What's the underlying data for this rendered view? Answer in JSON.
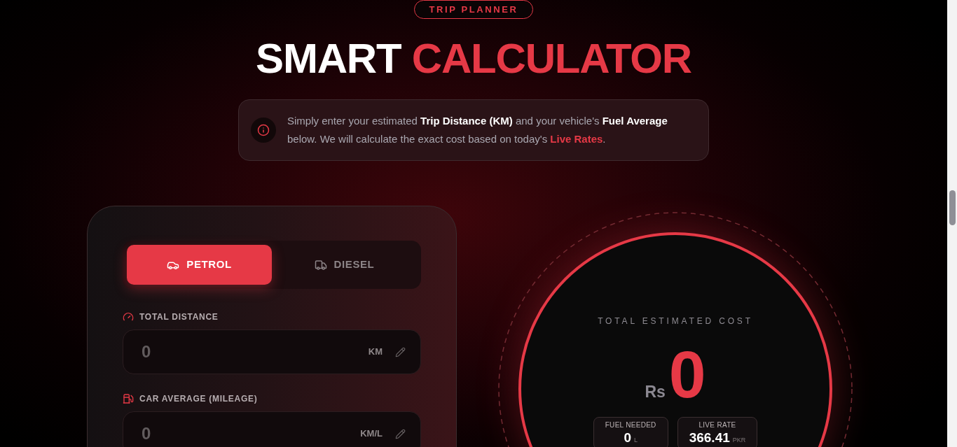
{
  "badge": {
    "label": "TRIP PLANNER"
  },
  "title": {
    "parts": [
      {
        "text": "SMART",
        "accent": false
      },
      {
        "text": "CALCULATOR",
        "accent": true
      }
    ]
  },
  "notice": {
    "segments": [
      {
        "text": "Simply enter your estimated ",
        "kind": "plain"
      },
      {
        "text": "Trip Distance (KM)",
        "kind": "strong"
      },
      {
        "text": " and your vehicle's ",
        "kind": "plain"
      },
      {
        "text": "Fuel Average",
        "kind": "strong"
      },
      {
        "text": " below. We will calculate the exact cost based on today's ",
        "kind": "plain"
      },
      {
        "text": "Live Rates",
        "kind": "accent"
      },
      {
        "text": ".",
        "kind": "plain"
      }
    ]
  },
  "fuel_types": [
    {
      "label": "PETROL",
      "selected": true
    },
    {
      "label": "DIESEL",
      "selected": false
    }
  ],
  "fields": [
    {
      "label": "TOTAL DISTANCE",
      "placeholder": "0",
      "unit": "KM"
    },
    {
      "label": "CAR AVERAGE (MILEAGE)",
      "placeholder": "0",
      "unit": "KM/L"
    }
  ],
  "result": {
    "label": "TOTAL ESTIMATED COST",
    "currency": "Rs",
    "amount": "0",
    "stats": [
      {
        "label": "FUEL NEEDED",
        "value": "0",
        "unit": "L"
      },
      {
        "label": "LIVE RATE",
        "value": "366.41",
        "unit": "PKR"
      }
    ]
  }
}
